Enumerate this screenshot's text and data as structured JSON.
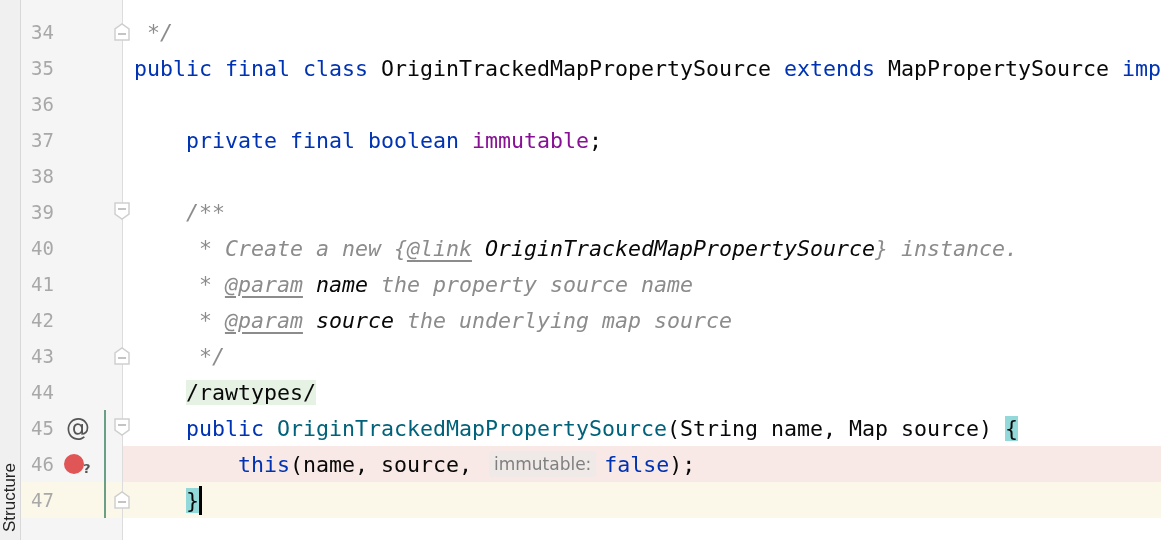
{
  "tool_window_tab": {
    "label": "Structure"
  },
  "lines": [
    {
      "number": "34",
      "fold": {
        "kind": "end"
      },
      "current": false,
      "changed": false,
      "caret": false,
      "tokens": [
        {
          "text": " */",
          "kind": "comment"
        }
      ]
    },
    {
      "number": "35",
      "current": false,
      "changed": false,
      "caret": false,
      "tokens": [
        {
          "text": "public final class ",
          "kind": "keyword"
        },
        {
          "text": "OriginTrackedMapPropertySource",
          "kind": "plain"
        },
        {
          "text": " extends ",
          "kind": "keyword"
        },
        {
          "text": "MapPropertySource ",
          "kind": "plain"
        },
        {
          "text": "imp",
          "kind": "keyword"
        }
      ]
    },
    {
      "number": "36",
      "current": false,
      "changed": false,
      "caret": false
    },
    {
      "number": "37",
      "current": false,
      "changed": false,
      "caret": false,
      "tokens": [
        {
          "text": "    private final boolean ",
          "kind": "keyword"
        },
        {
          "text": "immutable",
          "kind": "field"
        },
        {
          "text": ";",
          "kind": "plain"
        }
      ]
    },
    {
      "number": "38",
      "current": false,
      "changed": false,
      "caret": false
    },
    {
      "number": "39",
      "fold": {
        "kind": "start"
      },
      "current": false,
      "changed": false,
      "caret": false,
      "tokens": [
        {
          "text": "    /**",
          "kind": "comment"
        }
      ]
    },
    {
      "number": "40",
      "current": false,
      "changed": false,
      "caret": false,
      "tokens": [
        {
          "text": "     * Create a new {",
          "kind": "comment"
        },
        {
          "text": "@link",
          "kind": "doctag"
        },
        {
          "text": " OriginTrackedMapPropertySource",
          "kind": "docref"
        },
        {
          "text": "} instance.",
          "kind": "comment"
        }
      ]
    },
    {
      "number": "41",
      "current": false,
      "changed": false,
      "caret": false,
      "tokens": [
        {
          "text": "     * ",
          "kind": "comment"
        },
        {
          "text": "@param",
          "kind": "doctag"
        },
        {
          "text": " name",
          "kind": "docref"
        },
        {
          "text": " the property source name",
          "kind": "comment"
        }
      ]
    },
    {
      "number": "42",
      "current": false,
      "changed": false,
      "caret": false,
      "tokens": [
        {
          "text": "     * ",
          "kind": "comment"
        },
        {
          "text": "@param",
          "kind": "doctag"
        },
        {
          "text": " source",
          "kind": "docref"
        },
        {
          "text": " the underlying map source",
          "kind": "comment"
        }
      ]
    },
    {
      "number": "43",
      "fold": {
        "kind": "end"
      },
      "current": false,
      "changed": false,
      "caret": false,
      "tokens": [
        {
          "text": "     */",
          "kind": "comment"
        }
      ]
    },
    {
      "number": "44",
      "current": false,
      "changed": false,
      "caret": false,
      "tokens": [
        {
          "text": "    /rawtypes/",
          "kind": "suppressed"
        }
      ]
    },
    {
      "number": "45",
      "fold": {
        "kind": "start"
      },
      "gutter": {
        "kind": "override",
        "text": "@"
      },
      "current": false,
      "changed": true,
      "caret": false,
      "tokens": [
        {
          "text": "    public ",
          "kind": "keyword"
        },
        {
          "text": "OriginTrackedMapPropertySource",
          "kind": "method"
        },
        {
          "text": "(String name, Map source) ",
          "kind": "plain"
        },
        {
          "text": "{",
          "kind": "brace"
        }
      ]
    },
    {
      "number": "46",
      "gutter": {
        "kind": "breakpoint",
        "text": "?"
      },
      "current": false,
      "changed": true,
      "caret": false,
      "tokens": [
        {
          "text": "        this",
          "kind": "keyword"
        },
        {
          "text": "(name, source, ",
          "kind": "plain"
        },
        {
          "text": "immutable:",
          "kind": "hint"
        },
        {
          "text": "false",
          "kind": "keyword"
        },
        {
          "text": ");",
          "kind": "plain"
        }
      ]
    },
    {
      "number": "47",
      "fold": {
        "kind": "end"
      },
      "current": true,
      "changed": true,
      "caret": true,
      "tokens": [
        {
          "text": "    }",
          "kind": "brace"
        }
      ]
    }
  ]
}
